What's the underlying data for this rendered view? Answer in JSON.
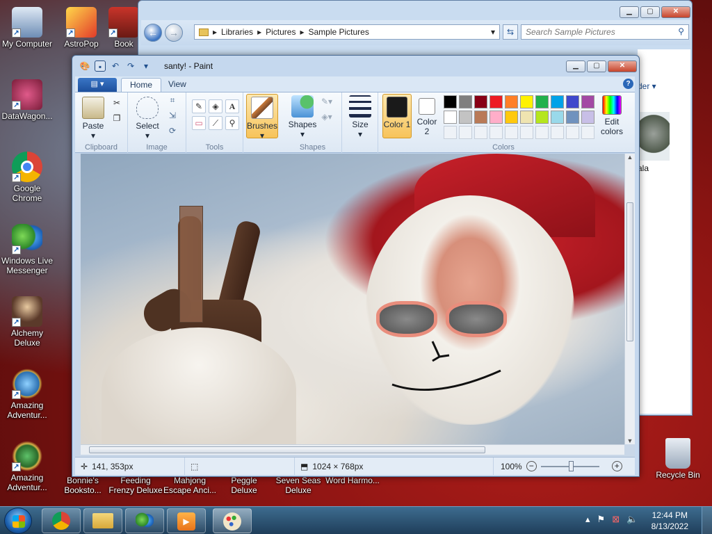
{
  "desktop": {
    "icons_left": [
      {
        "label": "My Computer",
        "icon": "computer-icon"
      },
      {
        "label": "DataWagon...",
        "icon": "datawagon-icon"
      },
      {
        "label": "Google Chrome",
        "icon": "chrome-icon"
      },
      {
        "label": "Windows Live Messenger",
        "icon": "messenger-icon"
      },
      {
        "label": "Alchemy Deluxe",
        "icon": "alchemy-icon"
      },
      {
        "label": "Amazing Adventur...",
        "icon": "amazing-adventures-icon"
      },
      {
        "label": "Amazing Adventur...",
        "icon": "amazing-adventures-2-icon"
      }
    ],
    "icons_col2": [
      {
        "label": "AstroPop",
        "icon": "astropop-icon"
      },
      {
        "label": "Book",
        "icon": "book-icon"
      }
    ],
    "icons_bottom": [
      {
        "label": "Bonnie's Booksto...",
        "icon": "bonnies-icon"
      },
      {
        "label": "Feeding Frenzy Deluxe",
        "icon": "feeding-frenzy-icon"
      },
      {
        "label": "Mahjong Escape Anci...",
        "icon": "mahjong-icon"
      },
      {
        "label": "Peggle Deluxe",
        "icon": "peggle-icon"
      },
      {
        "label": "Seven Seas Deluxe",
        "icon": "seven-seas-icon"
      },
      {
        "label": "Word Harmo...",
        "icon": "word-harmony-icon"
      }
    ],
    "recycle_bin": "Recycle Bin"
  },
  "explorer": {
    "breadcrumb": [
      "Libraries",
      "Pictures",
      "Sample Pictures"
    ],
    "search_placeholder": "Search Sample Pictures",
    "side_label": "der",
    "thumb_label": "ala"
  },
  "paint": {
    "title": "santy! - Paint",
    "tabs": {
      "file": "▾",
      "home": "Home",
      "view": "View"
    },
    "groups": {
      "clipboard": {
        "label": "Clipboard",
        "paste": "Paste"
      },
      "image": {
        "label": "Image",
        "select": "Select"
      },
      "tools": {
        "label": "Tools"
      },
      "brushes": {
        "label": "Brushes"
      },
      "shapes": {
        "label": "Shapes",
        "button": "Shapes"
      },
      "size": {
        "label": "Size"
      },
      "colors": {
        "label": "Colors",
        "color1": "Color 1",
        "color2": "Color 2",
        "edit": "Edit colors"
      }
    },
    "palette_row1": [
      "#000000",
      "#7f7f7f",
      "#880015",
      "#ed1c24",
      "#ff7f27",
      "#fff200",
      "#22b14c",
      "#00a2e8",
      "#3f48cc",
      "#a349a4"
    ],
    "palette_row2": [
      "#ffffff",
      "#c3c3c3",
      "#b97a57",
      "#ffaec9",
      "#ffc90e",
      "#efe4b0",
      "#b5e61d",
      "#99d9ea",
      "#7092be",
      "#c8bfe7"
    ],
    "color1_value": "#1a1a1a",
    "color2_value": "#ffffff",
    "status": {
      "cursor": "141, 353px",
      "size": "1024 × 768px",
      "zoom": "100%"
    }
  },
  "taskbar": {
    "time": "12:44 PM",
    "date": "8/13/2022"
  }
}
